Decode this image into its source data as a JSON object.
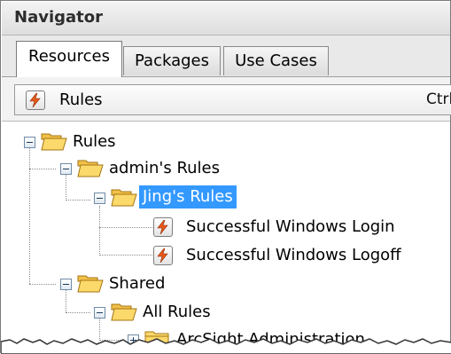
{
  "panel": {
    "title": "Navigator"
  },
  "tabs": [
    {
      "label": "Resources",
      "active": true
    },
    {
      "label": "Packages",
      "active": false
    },
    {
      "label": "Use Cases",
      "active": false
    }
  ],
  "toolbar": {
    "resource_label": "Rules",
    "shortcut_text": "Ctrl"
  },
  "tree": [
    {
      "label": "Rules",
      "icon": "folder-open-icon",
      "expanded": true
    },
    {
      "label": "admin's Rules",
      "icon": "folder-open-icon",
      "expanded": true
    },
    {
      "label": "Jing's Rules",
      "icon": "folder-open-icon",
      "expanded": true,
      "selected": true
    },
    {
      "label": "Successful Windows Login",
      "icon": "rule-icon"
    },
    {
      "label": "Successful Windows Logoff",
      "icon": "rule-icon"
    },
    {
      "label": "Shared",
      "icon": "folder-open-icon",
      "expanded": true
    },
    {
      "label": "All Rules",
      "icon": "folder-open-icon",
      "expanded": true
    },
    {
      "label": "ArcSight Administration",
      "icon": "folder-closed-icon",
      "expanded": false
    }
  ],
  "colors": {
    "selection": "#3399ff",
    "folder": "#f6c84a",
    "rule_bolt": "#e85a1a"
  }
}
